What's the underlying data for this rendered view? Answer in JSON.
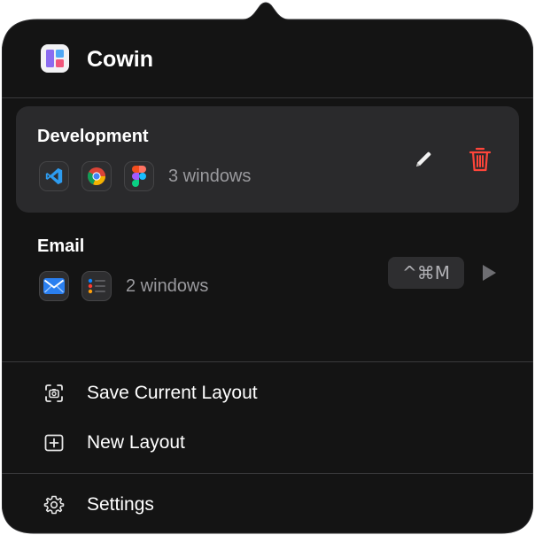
{
  "app": {
    "title": "Cowin",
    "icon": "cowin-app-icon"
  },
  "layouts": [
    {
      "name": "Development",
      "apps": [
        "vscode-icon",
        "chrome-icon",
        "figma-icon"
      ],
      "window_count": "3 windows",
      "selected": true,
      "actions": [
        "edit-icon",
        "trash-icon"
      ]
    },
    {
      "name": "Email",
      "apps": [
        "mail-icon",
        "reminders-icon"
      ],
      "window_count": "2 windows",
      "selected": false,
      "shortcut": "^⌘M",
      "actions": [
        "play-icon"
      ]
    }
  ],
  "menu": {
    "save_layout": "Save Current Layout",
    "new_layout": "New Layout",
    "settings": "Settings"
  },
  "colors": {
    "background": "#131313",
    "card_selected": "#2a2a2c",
    "danger": "#ff453a",
    "text_primary": "#ffffff",
    "text_secondary": "#9a9a9e"
  }
}
